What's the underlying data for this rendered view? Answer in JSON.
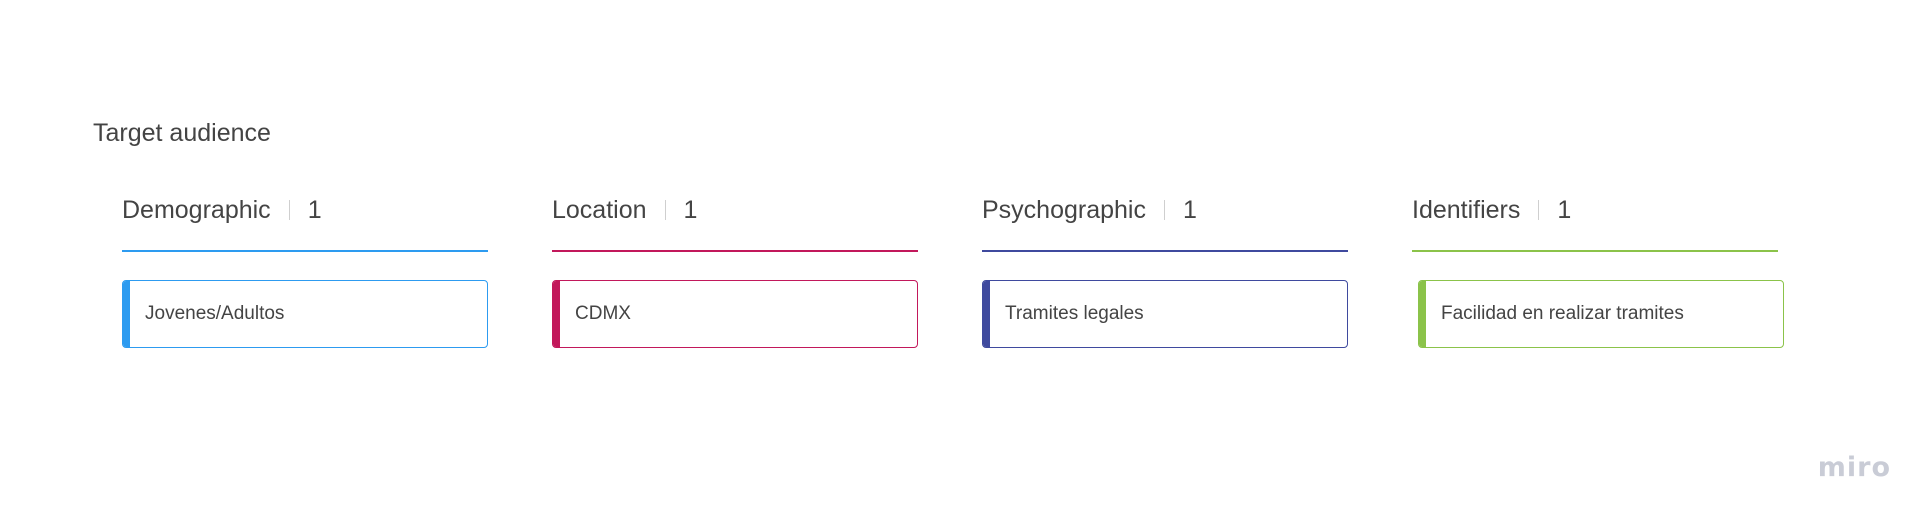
{
  "board": {
    "title": "Target audience",
    "columns": [
      {
        "label": "Demographic",
        "count": "1",
        "color": "#2d9bf0",
        "cards": [
          {
            "text": "Jovenes/Adultos"
          }
        ]
      },
      {
        "label": "Location",
        "count": "1",
        "color": "#c2185b",
        "cards": [
          {
            "text": "CDMX"
          }
        ]
      },
      {
        "label": "Psychographic",
        "count": "1",
        "color": "#3f4a9e",
        "cards": [
          {
            "text": "Tramites legales"
          }
        ]
      },
      {
        "label": "Identifiers",
        "count": "1",
        "color": "#8bc34a",
        "cards": [
          {
            "text": "Facilidad en realizar tramites"
          }
        ]
      }
    ]
  },
  "watermark": {
    "logo_text": "miro"
  }
}
